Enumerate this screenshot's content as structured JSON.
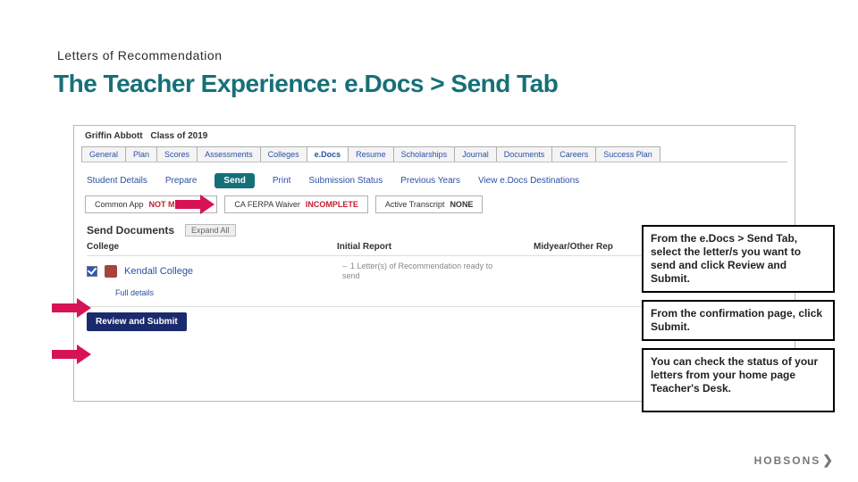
{
  "eyebrow": "Letters of Recommendation",
  "title": "The Teacher Experience: e.Docs > Send Tab",
  "student": {
    "name": "Griffin Abbott",
    "class_label": "Class of 2019"
  },
  "tabs": [
    "General",
    "Plan",
    "Scores",
    "Assessments",
    "Colleges",
    "e.Docs",
    "Resume",
    "Scholarships",
    "Journal",
    "Documents",
    "Careers",
    "Success Plan"
  ],
  "subtabs": {
    "student_details": "Student Details",
    "prepare": "Prepare",
    "send": "Send",
    "print": "Print",
    "submission_status": "Submission Status",
    "previous_years": "Previous Years",
    "view_destinations": "View e.Docs Destinations"
  },
  "status": {
    "ca_label": "Common App",
    "ca_value": "NOT MATCHED",
    "ferpa_label": "CA FERPA Waiver",
    "ferpa_value": "INCOMPLETE",
    "transcript_label": "Active Transcript",
    "transcript_value": "NONE"
  },
  "send_docs": {
    "header": "Send Documents",
    "expand": "Expand All",
    "col_college": "College",
    "col_initial": "Initial Report",
    "col_midyear": "Midyear/Other Rep"
  },
  "college": {
    "name": "Kendall College",
    "ir_note": "1 Letter(s) of Recommendation ready to send",
    "full_details": "Full details"
  },
  "review_button": "Review and Submit",
  "callouts": {
    "c1": "From the e.Docs > Send Tab, select the letter/s you want to send and click Review and Submit.",
    "c2": "From the confirmation page, click Submit.",
    "c3": "You can check the status of your letters from your home page Teacher's Desk."
  },
  "footer": {
    "brand": "HOBSONS",
    "chevron": "❯"
  }
}
